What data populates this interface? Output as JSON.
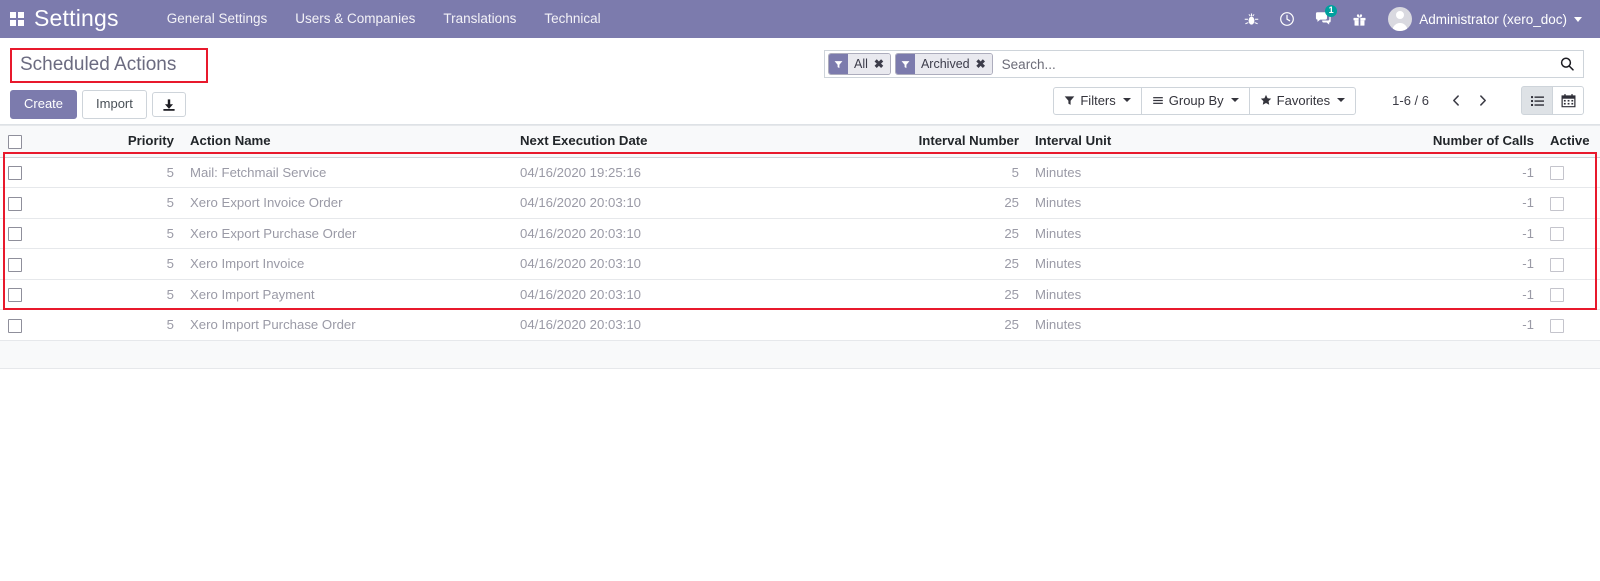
{
  "navbar": {
    "apps_icon": "apps-grid-icon",
    "brand": "Settings",
    "menu": [
      {
        "label": "General Settings"
      },
      {
        "label": "Users & Companies"
      },
      {
        "label": "Translations"
      },
      {
        "label": "Technical"
      }
    ],
    "icons": [
      {
        "name": "debug-bug-icon"
      },
      {
        "name": "clock-activity-icon"
      },
      {
        "name": "messages-chat-icon",
        "badge": "1"
      },
      {
        "name": "gift-icon"
      }
    ],
    "user": {
      "name": "Administrator (xero_doc)",
      "avatar": "user-avatar"
    }
  },
  "control_panel": {
    "title": "Scheduled Actions",
    "buttons": {
      "create": "Create",
      "import": "Import",
      "download_icon": "download-icon"
    },
    "search": {
      "placeholder": "Search...",
      "value": "",
      "search_icon": "search-magnifier-icon",
      "facets": [
        {
          "label": "All",
          "icon": "filter-funnel-icon",
          "remove": "✖"
        },
        {
          "label": "Archived",
          "icon": "filter-funnel-icon",
          "remove": "✖"
        }
      ]
    },
    "dropdowns": [
      {
        "label": "Filters",
        "icon": "filter-funnel-icon"
      },
      {
        "label": "Group By",
        "icon": "group-lines-icon"
      },
      {
        "label": "Favorites",
        "icon": "star-icon"
      }
    ],
    "pager": {
      "count": "1-6 / 6",
      "prev_icon": "chevron-left-icon",
      "next_icon": "chevron-right-icon"
    },
    "views": [
      {
        "name": "list-view",
        "icon": "list-icon",
        "active": true
      },
      {
        "name": "calendar-view",
        "icon": "calendar-icon",
        "active": false
      }
    ]
  },
  "table": {
    "columns": [
      {
        "key": "priority",
        "label": "Priority",
        "align": "right"
      },
      {
        "key": "name",
        "label": "Action Name",
        "align": "left"
      },
      {
        "key": "next_exec",
        "label": "Next Execution Date",
        "align": "left"
      },
      {
        "key": "interval",
        "label": "Interval Number",
        "align": "right"
      },
      {
        "key": "unit",
        "label": "Interval Unit",
        "align": "left"
      },
      {
        "key": "calls",
        "label": "Number of Calls",
        "align": "right"
      },
      {
        "key": "active",
        "label": "Active",
        "align": "left"
      }
    ],
    "rows": [
      {
        "priority": "5",
        "name": "Mail: Fetchmail Service",
        "next_exec": "04/16/2020 19:25:16",
        "interval": "5",
        "unit": "Minutes",
        "calls": "-1",
        "active": false
      },
      {
        "priority": "5",
        "name": "Xero Export Invoice Order",
        "next_exec": "04/16/2020 20:03:10",
        "interval": "25",
        "unit": "Minutes",
        "calls": "-1",
        "active": false
      },
      {
        "priority": "5",
        "name": "Xero Export Purchase Order",
        "next_exec": "04/16/2020 20:03:10",
        "interval": "25",
        "unit": "Minutes",
        "calls": "-1",
        "active": false
      },
      {
        "priority": "5",
        "name": "Xero Import Invoice",
        "next_exec": "04/16/2020 20:03:10",
        "interval": "25",
        "unit": "Minutes",
        "calls": "-1",
        "active": false
      },
      {
        "priority": "5",
        "name": "Xero Import Payment",
        "next_exec": "04/16/2020 20:03:10",
        "interval": "25",
        "unit": "Minutes",
        "calls": "-1",
        "active": false
      },
      {
        "priority": "5",
        "name": "Xero Import Purchase Order",
        "next_exec": "04/16/2020 20:03:10",
        "interval": "25",
        "unit": "Minutes",
        "calls": "-1",
        "active": false
      }
    ]
  },
  "annotations": {
    "title_highlight_color": "#e8192c",
    "rows_highlight_color": "#e8192c"
  },
  "theme": {
    "primary": "#7c7bad",
    "badge": "#00a09d",
    "muted_text": "#9a9aa6"
  }
}
